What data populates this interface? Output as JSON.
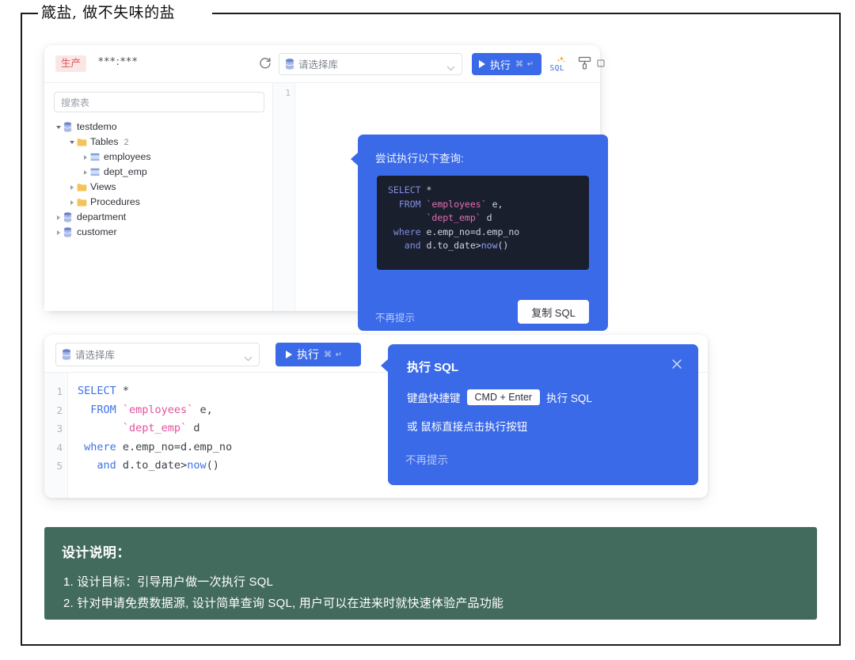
{
  "frame": {
    "title": "箴盐, 做不失味的盐"
  },
  "panel1": {
    "toolbar": {
      "env_badge": "生产",
      "connection": "***:***",
      "refresh_icon": "refresh-icon",
      "db_placeholder": "请选择库",
      "exec_label": "执行",
      "exec_shortcut": "⌘ ↵",
      "ai_sql_icon": "ai-sql-icon",
      "format_icon": "format-sql-icon",
      "more_icon": "more-icon"
    },
    "sidebar": {
      "search_placeholder": "搜索表",
      "tree": [
        {
          "label": "testdemo",
          "indent": 0,
          "caret": "down",
          "icon": "database",
          "count": ""
        },
        {
          "label": "Tables",
          "indent": 1,
          "caret": "down",
          "icon": "folder",
          "count": "2"
        },
        {
          "label": "employees",
          "indent": 2,
          "caret": "right",
          "icon": "table",
          "count": ""
        },
        {
          "label": "dept_emp",
          "indent": 2,
          "caret": "right",
          "icon": "table",
          "count": ""
        },
        {
          "label": "Views",
          "indent": 1,
          "caret": "right",
          "icon": "folder",
          "count": ""
        },
        {
          "label": "Procedures",
          "indent": 1,
          "caret": "right",
          "icon": "folder",
          "count": ""
        },
        {
          "label": "department",
          "indent": 0,
          "caret": "right",
          "icon": "database",
          "count": ""
        },
        {
          "label": "customer",
          "indent": 0,
          "caret": "right",
          "icon": "database",
          "count": ""
        }
      ]
    },
    "editor": {
      "line_number": "1"
    },
    "tooltip": {
      "heading": "尝试执行以下查询:",
      "dismiss_label": "不再提示",
      "copy_label": "复制 SQL"
    }
  },
  "panel2": {
    "toolbar": {
      "db_placeholder": "请选择库",
      "exec_label": "执行",
      "exec_shortcut": "⌘ ↵"
    },
    "editor": {
      "line_numbers": [
        "1",
        "2",
        "3",
        "4",
        "5"
      ]
    },
    "popup": {
      "title": "执行 SQL",
      "close_icon": "close-icon",
      "row1_prefix": "键盘快捷键",
      "row1_kbd": "CMD + Enter",
      "row1_suffix": "执行 SQL",
      "row2": "或 鼠标直接点击执行按钮",
      "dismiss_label": "不再提示"
    }
  },
  "sql": {
    "lines": [
      {
        "parts": [
          {
            "t": "SELECT",
            "c": "k"
          },
          {
            "t": " *",
            "c": "pl"
          }
        ]
      },
      {
        "parts": [
          {
            "t": "  FROM ",
            "c": "k"
          },
          {
            "t": "`employees`",
            "c": "id"
          },
          {
            "t": " e,",
            "c": "pl"
          }
        ]
      },
      {
        "parts": [
          {
            "t": "       ",
            "c": "pl"
          },
          {
            "t": "`dept_emp`",
            "c": "id"
          },
          {
            "t": " d",
            "c": "pl"
          }
        ]
      },
      {
        "parts": [
          {
            "t": " where",
            "c": "k"
          },
          {
            "t": " e.emp_no=d.emp_no",
            "c": "pl"
          }
        ]
      },
      {
        "parts": [
          {
            "t": "   and",
            "c": "k"
          },
          {
            "t": " d.to_date>",
            "c": "pl"
          },
          {
            "t": "now",
            "c": "fn"
          },
          {
            "t": "()",
            "c": "pl"
          }
        ]
      }
    ]
  },
  "note": {
    "title": "设计说明：",
    "line1": "1. 设计目标：引导用户做一次执行 SQL",
    "line2": "2. 针对申请免费数据源, 设计简单查询 SQL, 用户可以在进来时就快速体验产品功能"
  },
  "colors": {
    "accent_blue": "#3b6ae8",
    "note_green": "#436b5d",
    "badge_red": "#e05252",
    "code_bg_dark": "#1a1f2e"
  }
}
